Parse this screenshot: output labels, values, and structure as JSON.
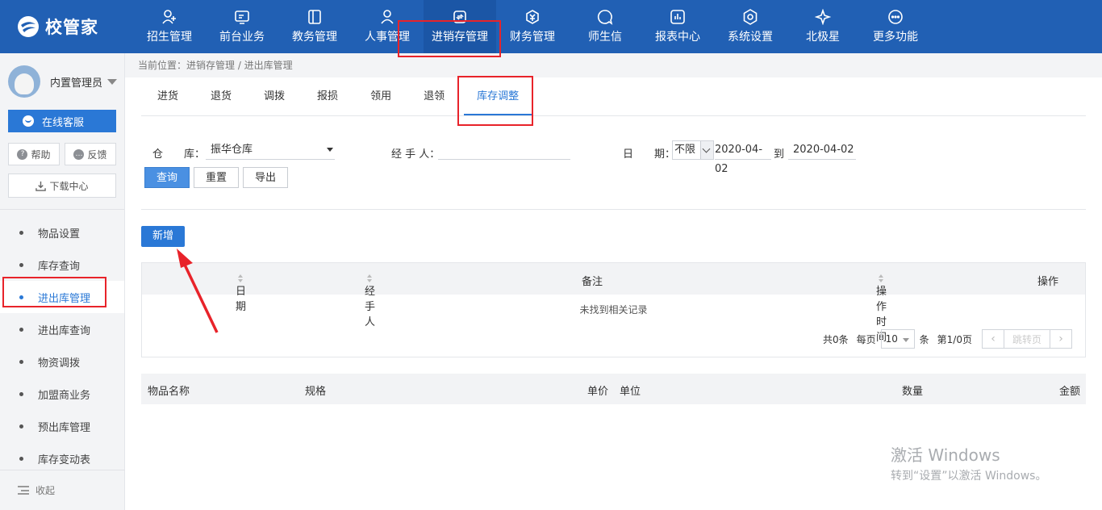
{
  "app": {
    "logo_text": "校管家"
  },
  "nav": [
    {
      "label": "招生管理",
      "icon": "user-plus-icon"
    },
    {
      "label": "前台业务",
      "icon": "screen-icon"
    },
    {
      "label": "教务管理",
      "icon": "book-icon"
    },
    {
      "label": "人事管理",
      "icon": "person-icon"
    },
    {
      "label": "进销存管理",
      "icon": "inventory-icon",
      "active": true
    },
    {
      "label": "财务管理",
      "icon": "money-icon"
    },
    {
      "label": "师生信",
      "icon": "chat-icon"
    },
    {
      "label": "报表中心",
      "icon": "chart-icon"
    },
    {
      "label": "系统设置",
      "icon": "settings-icon"
    },
    {
      "label": "北极星",
      "icon": "star-icon"
    },
    {
      "label": "更多功能",
      "icon": "more-icon"
    }
  ],
  "sidebar": {
    "user_name": "内置管理员",
    "online_service": "在线客服",
    "help": "帮助",
    "feedback": "反馈",
    "download_center": "下载中心",
    "menu": [
      {
        "label": "物品设置"
      },
      {
        "label": "库存查询"
      },
      {
        "label": "进出库管理",
        "active": true
      },
      {
        "label": "进出库查询"
      },
      {
        "label": "物资调拨"
      },
      {
        "label": "加盟商业务"
      },
      {
        "label": "预出库管理"
      },
      {
        "label": "库存变动表"
      }
    ],
    "collapse": "收起"
  },
  "breadcrumb": "当前位置：进销存管理 / 进出库管理",
  "tabs": [
    "进货",
    "退货",
    "调拨",
    "报损",
    "领用",
    "退领",
    "库存调整"
  ],
  "active_tab": "库存调整",
  "filters": {
    "warehouse_label": "仓　　库：",
    "warehouse_value": "振华仓库",
    "handler_label": "经 手 人：",
    "handler_value": "",
    "date_label": "日　　期：",
    "date_range": "不限",
    "date_from": "2020-04-02",
    "date_to_sep": "到",
    "date_to": "2020-04-02"
  },
  "actions": {
    "query": "查询",
    "reset": "重置",
    "export": "导出",
    "add": "新增"
  },
  "table1": {
    "columns": [
      "日期",
      "经手人",
      "备注",
      "操作时间",
      "操作"
    ],
    "empty_text": "未找到相关记录",
    "pager": {
      "total": "共0条",
      "per_page_label": "每页",
      "per_page_value": "10",
      "unit": "条",
      "page_info": "第1/0页",
      "jump": "跳转页"
    }
  },
  "table2": {
    "columns": [
      "物品名称",
      "规格",
      "单价",
      "单位",
      "数量",
      "金额"
    ]
  },
  "watermark": {
    "line1": "激活 Windows",
    "line2": "转到“设置”以激活 Windows。"
  }
}
